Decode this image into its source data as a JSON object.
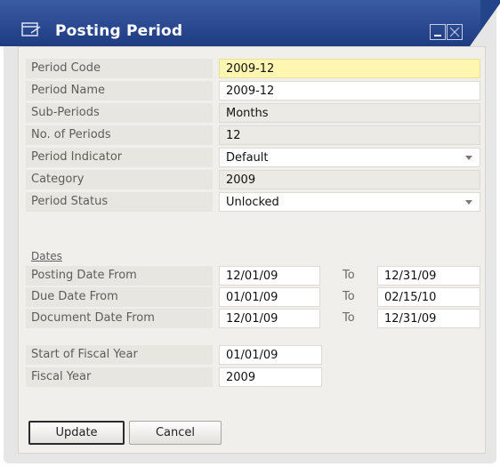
{
  "window": {
    "title": "Posting Period"
  },
  "fields": [
    {
      "label": "Period Code",
      "value": "2009-12",
      "style": "focus"
    },
    {
      "label": "Period Name",
      "value": "2009-12",
      "style": "white"
    },
    {
      "label": "Sub-Periods",
      "value": "Months",
      "style": "ro"
    },
    {
      "label": "No. of Periods",
      "value": "12",
      "style": "ro"
    },
    {
      "label": "Period Indicator",
      "value": "Default",
      "style": "white",
      "dropdown": true
    },
    {
      "label": "Category",
      "value": "2009",
      "style": "ro"
    },
    {
      "label": "Period Status",
      "value": "Unlocked",
      "style": "white",
      "dropdown": true
    }
  ],
  "dates": {
    "section_label": "Dates",
    "to_label": "To",
    "rows": [
      {
        "label": "Posting Date From",
        "from": "12/01/09",
        "to": "12/31/09"
      },
      {
        "label": "Due Date From",
        "from": "01/01/09",
        "to": "02/15/10"
      },
      {
        "label": "Document Date From",
        "from": "12/01/09",
        "to": "12/31/09"
      }
    ]
  },
  "fiscal": [
    {
      "label": "Start of Fiscal Year",
      "value": "01/01/09"
    },
    {
      "label": "Fiscal Year",
      "value": "2009"
    }
  ],
  "buttons": {
    "update": "Update",
    "cancel": "Cancel"
  },
  "colors": {
    "title_bar": "#24448a",
    "focus_field": "#fff6b2",
    "panel": "#f0efec"
  }
}
